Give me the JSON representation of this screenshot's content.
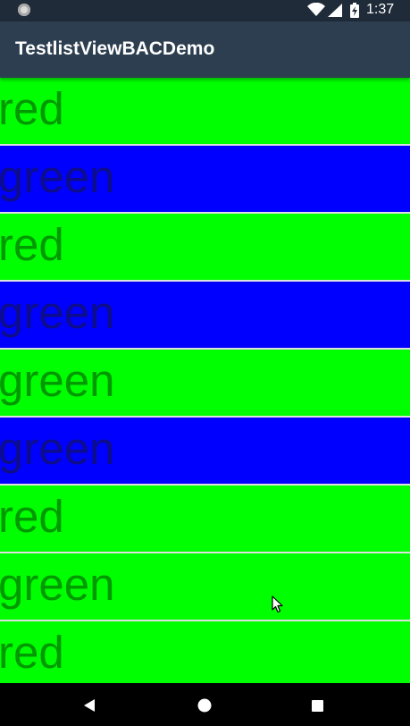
{
  "status_bar": {
    "time": "1:37",
    "icons": [
      "notification-dot-icon",
      "wifi-icon",
      "signal-icon",
      "battery-charging-icon"
    ]
  },
  "app_bar": {
    "title": "TestlistViewBACDemo"
  },
  "list": {
    "items": [
      {
        "label": "red",
        "bg": "#00ff00",
        "fg": "#009900"
      },
      {
        "label": "green",
        "bg": "#0000ff",
        "fg": "#0d0d8c"
      },
      {
        "label": "red",
        "bg": "#00ff00",
        "fg": "#009900"
      },
      {
        "label": "green",
        "bg": "#0000ff",
        "fg": "#0d0d8c"
      },
      {
        "label": "green",
        "bg": "#00ff00",
        "fg": "#009900"
      },
      {
        "label": "green",
        "bg": "#0000ff",
        "fg": "#0d0d8c"
      },
      {
        "label": "red",
        "bg": "#00ff00",
        "fg": "#009900"
      },
      {
        "label": "green",
        "bg": "#00ff00",
        "fg": "#009900"
      },
      {
        "label": "red",
        "bg": "#00ff00",
        "fg": "#009900"
      }
    ]
  },
  "nav_bar": {
    "icons": [
      "back-icon",
      "home-icon",
      "recents-icon"
    ]
  },
  "colors": {
    "status_bar": "#1f2b38",
    "app_bar": "#2c3e50",
    "nav_bar": "#000000",
    "divider": "#e0e0e0"
  }
}
